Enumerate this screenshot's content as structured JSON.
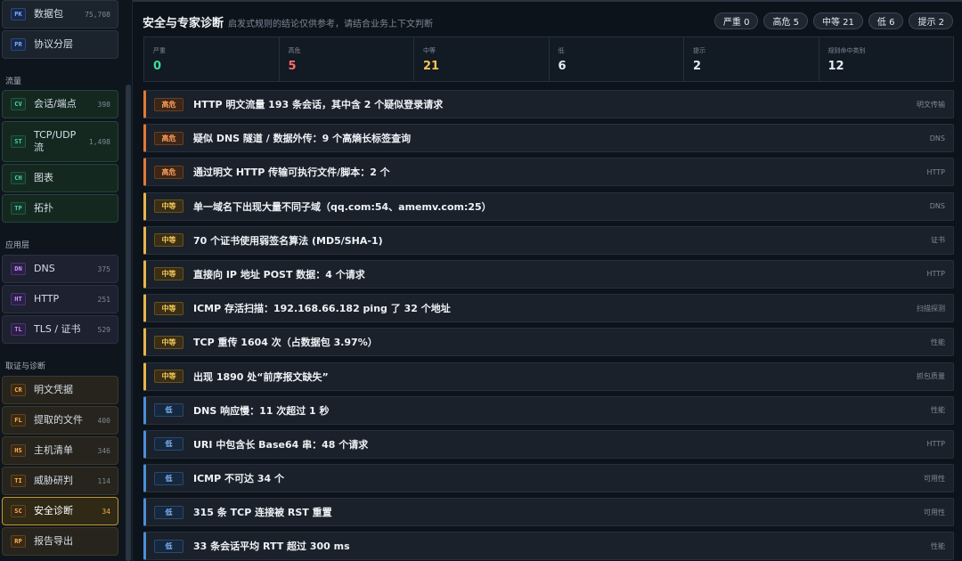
{
  "sidebar": {
    "base_items": [
      {
        "badge": "PK",
        "label": "数据包",
        "count": "75,708"
      },
      {
        "badge": "PR",
        "label": "协议分层",
        "count": ""
      }
    ],
    "sections": {
      "flow": "流量",
      "app": "应用层",
      "forensic": "取证与诊断"
    },
    "flow_items": [
      {
        "badge": "CV",
        "label": "会话/端点",
        "count": "398"
      },
      {
        "badge": "ST",
        "label": "TCP/UDP 流",
        "count": "1,498"
      },
      {
        "badge": "CH",
        "label": "图表",
        "count": ""
      },
      {
        "badge": "TP",
        "label": "拓扑",
        "count": ""
      }
    ],
    "app_items": [
      {
        "badge": "DN",
        "label": "DNS",
        "count": "375"
      },
      {
        "badge": "HT",
        "label": "HTTP",
        "count": "251"
      },
      {
        "badge": "TL",
        "label": "TLS / 证书",
        "count": "529"
      }
    ],
    "forensic_items": [
      {
        "badge": "CR",
        "label": "明文凭据",
        "count": ""
      },
      {
        "badge": "FL",
        "label": "提取的文件",
        "count": "400"
      },
      {
        "badge": "HS",
        "label": "主机清单",
        "count": "346"
      },
      {
        "badge": "TI",
        "label": "威胁研判",
        "count": "114"
      },
      {
        "badge": "SC",
        "label": "安全诊断",
        "count": "34"
      },
      {
        "badge": "RP",
        "label": "报告导出",
        "count": ""
      }
    ]
  },
  "header": {
    "title": "安全与专家诊断",
    "subtitle": "启发式规则的结论仅供参考，请结合业务上下文判断",
    "pills": [
      "严重 0",
      "高危 5",
      "中等 21",
      "低 6",
      "提示 2"
    ]
  },
  "stats": [
    {
      "label": "严重",
      "value": "0",
      "color": "#3ddc97"
    },
    {
      "label": "高危",
      "value": "5",
      "color": "#ff6b6b"
    },
    {
      "label": "中等",
      "value": "21",
      "color": "#f5c451"
    },
    {
      "label": "低",
      "value": "6",
      "color": "#e6ebf1"
    },
    {
      "label": "提示",
      "value": "2",
      "color": "#e6ebf1"
    },
    {
      "label": "规则命中类别",
      "value": "12",
      "color": "#e6ebf1"
    }
  ],
  "alerts": [
    {
      "level": "high",
      "sev": "高危",
      "text": "HTTP 明文流量 193 条会话，其中含 2 个疑似登录请求",
      "tag": "明文传输"
    },
    {
      "level": "high",
      "sev": "高危",
      "text": "疑似 DNS 隧道 / 数据外传：9 个高熵长标签查询",
      "tag": "DNS"
    },
    {
      "level": "high",
      "sev": "高危",
      "text": "通过明文 HTTP 传输可执行文件/脚本：2 个",
      "tag": "HTTP"
    },
    {
      "level": "mid",
      "sev": "中等",
      "text": "单一域名下出现大量不同子域（qq.com:54、amemv.com:25）",
      "tag": "DNS"
    },
    {
      "level": "mid",
      "sev": "中等",
      "text": "70 个证书使用弱签名算法 (MD5/SHA-1)",
      "tag": "证书"
    },
    {
      "level": "mid",
      "sev": "中等",
      "text": "直接向 IP 地址 POST 数据：4 个请求",
      "tag": "HTTP"
    },
    {
      "level": "mid",
      "sev": "中等",
      "text": "ICMP 存活扫描：192.168.66.182 ping 了 32 个地址",
      "tag": "扫描探测"
    },
    {
      "level": "mid",
      "sev": "中等",
      "text": "TCP 重传 1604 次（占数据包 3.97%）",
      "tag": "性能"
    },
    {
      "level": "mid",
      "sev": "中等",
      "text": "出现 1890 处“前序报文缺失”",
      "tag": "抓包质量"
    },
    {
      "level": "low",
      "sev": "低",
      "text": "DNS 响应慢：11 次超过 1 秒",
      "tag": "性能"
    },
    {
      "level": "low",
      "sev": "低",
      "text": "URI 中包含长 Base64 串：48 个请求",
      "tag": "HTTP"
    },
    {
      "level": "low",
      "sev": "低",
      "text": "ICMP 不可达 34 个",
      "tag": "可用性"
    },
    {
      "level": "low",
      "sev": "低",
      "text": "315 条 TCP 连接被 RST 重置",
      "tag": "可用性"
    },
    {
      "level": "low",
      "sev": "低",
      "text": "33 条会话平均 RTT 超过 300 ms",
      "tag": "性能"
    }
  ]
}
